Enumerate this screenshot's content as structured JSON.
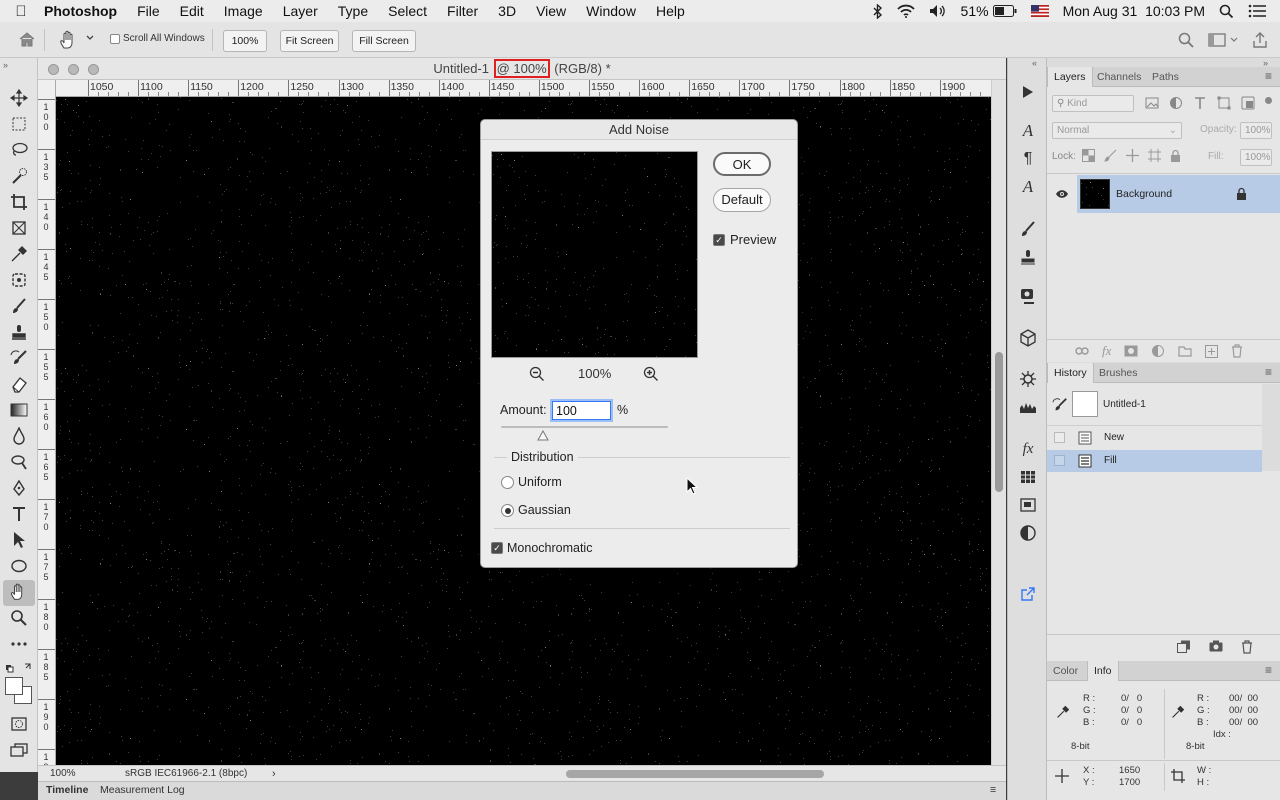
{
  "menubar": {
    "app_name": "Photoshop",
    "items": [
      "File",
      "Edit",
      "Image",
      "Layer",
      "Type",
      "Select",
      "Filter",
      "3D",
      "View",
      "Window",
      "Help"
    ],
    "battery": "51%",
    "clock": "Mon Aug 31  10:03 PM"
  },
  "options_bar": {
    "scroll_all_windows": "Scroll All Windows",
    "zoom_value": "100%",
    "fit_screen": "Fit Screen",
    "fill_screen": "Fill Screen"
  },
  "document": {
    "title_name": "Untitled-1",
    "title_zoom": "@ 100%",
    "title_mode": "(RGB/8) *",
    "ruler_h": [
      "1050",
      "1100",
      "1150",
      "1200",
      "1250",
      "1300",
      "1350",
      "1400",
      "1450",
      "1500",
      "1550",
      "1600",
      "1650",
      "1700",
      "1750",
      "1800",
      "1850",
      "1900"
    ],
    "ruler_v": [
      "1\n0\n0",
      "1\n3\n5",
      "1\n4\n0",
      "1\n4\n5",
      "1\n5\n0",
      "1\n5\n5",
      "1\n6\n0",
      "1\n6\n5",
      "1\n7\n0",
      "1\n7\n5",
      "1\n8\n0",
      "1\n8\n5",
      "1\n9\n0",
      "1\n9\n5"
    ],
    "status_zoom": "100%",
    "status_profile": "sRGB IEC61966-2.1 (8bpc)"
  },
  "bottom_tabs": [
    "Timeline",
    "Measurement Log"
  ],
  "dialog": {
    "title": "Add Noise",
    "ok": "OK",
    "default": "Default",
    "preview_label": "Preview",
    "preview_checked": true,
    "zoom_percent": "100%",
    "amount_label": "Amount:",
    "amount_value": "100",
    "amount_unit": "%",
    "amount_slider_fraction": 0.25,
    "distribution_label": "Distribution",
    "uniform_label": "Uniform",
    "gaussian_label": "Gaussian",
    "selected_distribution": "Gaussian",
    "monochromatic_label": "Monochromatic",
    "monochromatic_checked": true
  },
  "layers_panel": {
    "tabs": [
      "Layers",
      "Channels",
      "Paths"
    ],
    "kind_placeholder": "Kind",
    "blend_mode": "Normal",
    "opacity_label": "Opacity:",
    "opacity_value": "100%",
    "lock_label": "Lock:",
    "fill_label": "Fill:",
    "fill_value": "100%",
    "layer_name": "Background"
  },
  "history_panel": {
    "tabs": [
      "History",
      "Brushes"
    ],
    "snapshot": "Untitled-1",
    "states": [
      "New",
      "Fill"
    ],
    "selected_state": "Fill"
  },
  "info_panel": {
    "tabs": [
      "Color",
      "Info"
    ],
    "left": {
      "r_label": "R :",
      "r_value": "0/   0",
      "g_label": "G :",
      "g_value": "0/   0",
      "b_label": "B :",
      "b_value": "0/   0",
      "bit": "8-bit"
    },
    "right": {
      "r_label": "R :",
      "r_value": "00/  00",
      "g_label": "G :",
      "g_value": "00/  00",
      "b_label": "B :",
      "b_value": "00/  00",
      "idx_label": "Idx :",
      "bit": "8-bit"
    },
    "x_label": "X :",
    "x_value": "1650",
    "y_label": "Y :",
    "y_value": "1700",
    "w_label": "W :",
    "h_label": "H :"
  },
  "colors": {
    "accent": "#3478f6",
    "selection": "#b7cbe6",
    "highlight_box": "#e02020"
  }
}
